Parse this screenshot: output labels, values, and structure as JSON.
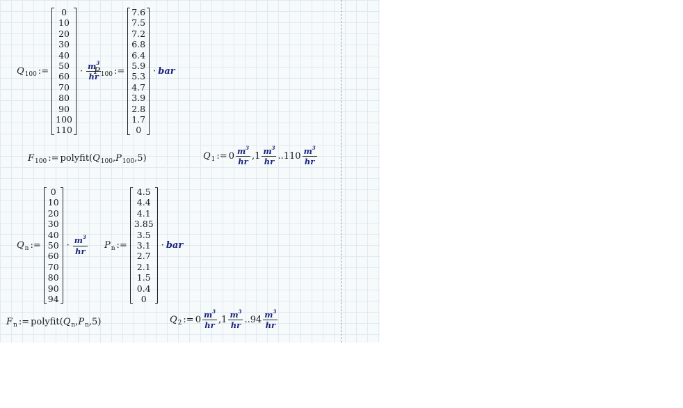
{
  "worksheet": {
    "defs": [
      {
        "id": "q100",
        "var": "Q",
        "sub": "100",
        "assign": ":=",
        "values": [
          "0",
          "10",
          "20",
          "30",
          "40",
          "50",
          "60",
          "70",
          "80",
          "90",
          "100",
          "110"
        ],
        "unit_num": "m",
        "unit_exp": "3",
        "unit_den": "hr"
      },
      {
        "id": "p100",
        "var": "P",
        "sub": "100",
        "assign": ":=",
        "values": [
          "7.6",
          "7.5",
          "7.2",
          "6.8",
          "6.4",
          "5.9",
          "5.3",
          "4.7",
          "3.9",
          "2.8",
          "1.7",
          "0"
        ],
        "unit": "bar"
      },
      {
        "id": "qn",
        "var": "Q",
        "sub": "n",
        "assign": ":=",
        "values": [
          "0",
          "10",
          "20",
          "30",
          "40",
          "50",
          "60",
          "70",
          "80",
          "90",
          "94"
        ],
        "unit_num": "m",
        "unit_exp": "3",
        "unit_den": "hr"
      },
      {
        "id": "pn",
        "var": "P",
        "sub": "n",
        "assign": ":=",
        "values": [
          "4.5",
          "4.4",
          "4.1",
          "3.85",
          "3.5",
          "3.1",
          "2.7",
          "2.1",
          "1.5",
          "0.4",
          "0"
        ],
        "unit": "bar"
      }
    ],
    "f100": {
      "var": "F",
      "sub": "100",
      "assign": ":=",
      "func": "polyfit",
      "arg1": "Q",
      "arg1_sub": "100",
      "arg2": "P",
      "arg2_sub": "100",
      "arg3": "5"
    },
    "fn": {
      "var": "F",
      "sub": "n",
      "assign": ":=",
      "func": "polyfit",
      "arg1": "Q",
      "arg1_sub": "n",
      "arg2": "P",
      "arg2_sub": "n",
      "arg3": "5"
    },
    "q1": {
      "var": "Q",
      "sub": "1",
      "assign": ":=",
      "start": "0",
      "second": "1",
      "end": "110",
      "range": "..",
      "comma": ",",
      "unit_num": "m",
      "unit_exp": "3",
      "unit_den": "hr"
    },
    "q2": {
      "var": "Q",
      "sub": "2",
      "assign": ":=",
      "start": "0",
      "second": "1",
      "end": "94",
      "range": "..",
      "comma": ",",
      "unit_num": "m",
      "unit_exp": "3",
      "unit_den": "hr"
    },
    "dot_symbol": "·"
  }
}
